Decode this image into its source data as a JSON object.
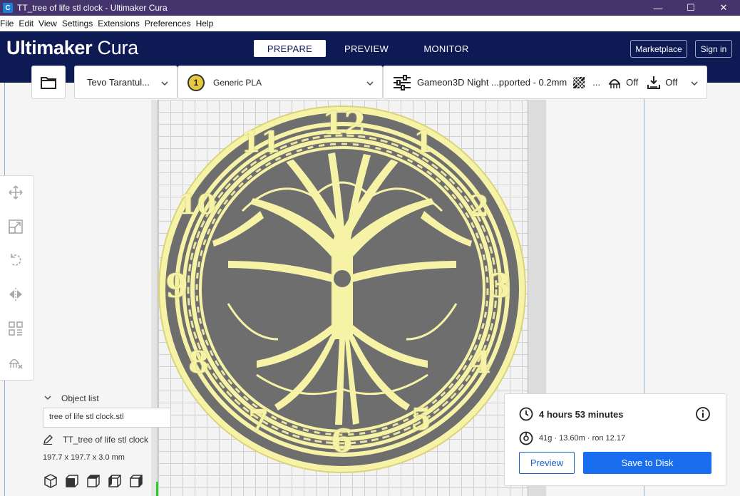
{
  "window": {
    "title": "TT_tree of life stl clock - Ultimaker Cura",
    "controls": {
      "minimize": "—",
      "maximize": "☐",
      "close": "✕"
    }
  },
  "menu": [
    "File",
    "Edit",
    "View",
    "Settings",
    "Extensions",
    "Preferences",
    "Help"
  ],
  "header": {
    "brand_bold": "Ultimaker",
    "brand_light": " Cura",
    "tabs": [
      {
        "label": "PREPARE",
        "active": true
      },
      {
        "label": "PREVIEW",
        "active": false
      },
      {
        "label": "MONITOR",
        "active": false
      }
    ],
    "marketplace_label": "Marketplace",
    "signin_label": "Sign in"
  },
  "toolbar": {
    "printer": "Tevo Tarantul...",
    "extruder_number": "1",
    "material": "Generic PLA",
    "profile": "Gameon3D Night ...pported - 0.2mm",
    "infill_ellipsis": "...",
    "support": "Off",
    "adhesion": "Off"
  },
  "clock_numerals": [
    "12",
    "1",
    "2",
    "3",
    "4",
    "5",
    "6",
    "7",
    "8",
    "9",
    "10",
    "11"
  ],
  "object_list": {
    "heading": "Object list",
    "item": "tree of life stl clock.stl",
    "job_name": "TT_tree of life stl clock",
    "dimensions": "197.7 x 197.7 x 3.0 mm"
  },
  "print": {
    "time": "4 hours 53 minutes",
    "material_info": "41g · 13.60m · ron 12.17",
    "preview_label": "Preview",
    "save_label": "Save to Disk"
  },
  "colors": {
    "header_bg": "#0e1a54",
    "titlebar_bg": "#43346b",
    "model_yellow": "#f6f3a6",
    "primary_blue": "#196ef0"
  }
}
